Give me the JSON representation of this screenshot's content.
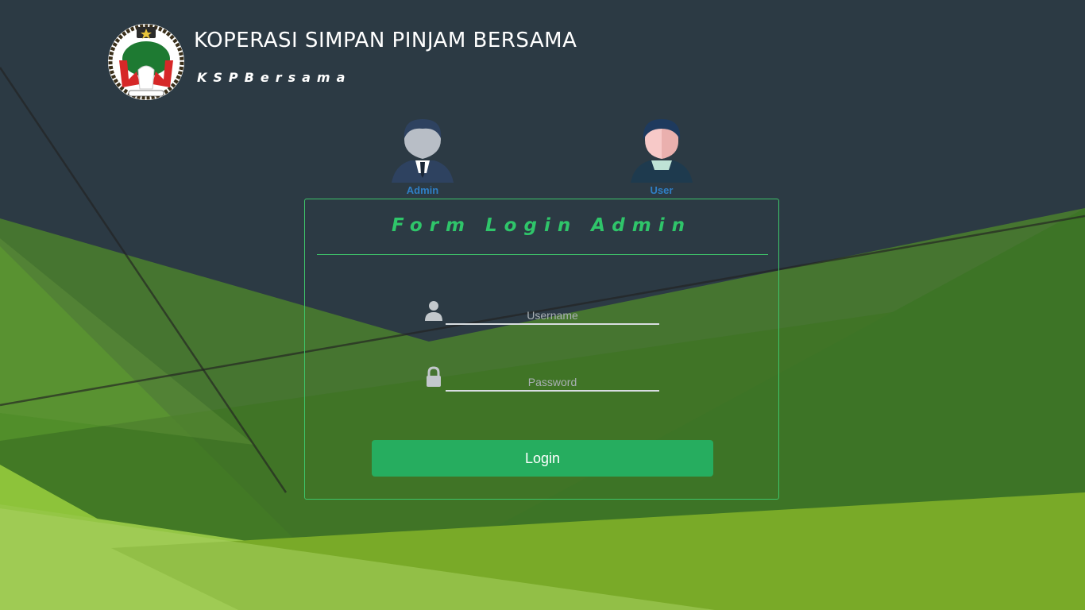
{
  "header": {
    "title": "KOPERASI SIMPAN PINJAM BERSAMA",
    "subtitle": "KSPBersama",
    "logo_icon": "koperasi-indonesia-emblem"
  },
  "roles": [
    {
      "label": "Admin",
      "icon": "admin-avatar-icon"
    },
    {
      "label": "User",
      "icon": "user-avatar-icon"
    }
  ],
  "form": {
    "title": "Form Login Admin",
    "username_placeholder": "Username",
    "username_value": "",
    "password_placeholder": "Password",
    "password_value": "",
    "login_label": "Login"
  },
  "colors": {
    "background": "#2c3a44",
    "accent": "#26ad5f",
    "border": "#3ec46a",
    "role_label": "#2f7fc6"
  }
}
